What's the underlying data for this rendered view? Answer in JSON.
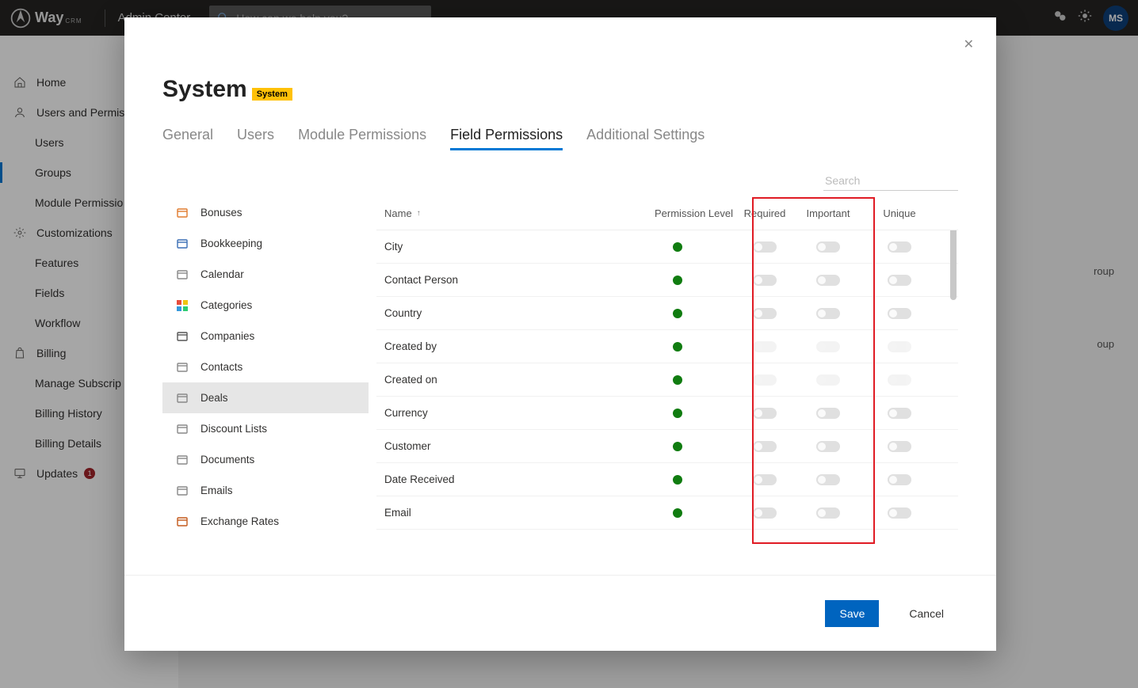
{
  "header": {
    "brand": "Way",
    "brand_sub": "CRM",
    "app_title": "Admin Center",
    "search_placeholder": "How can we help you?",
    "avatar_initials": "MS"
  },
  "sidebar": {
    "items": [
      {
        "label": "Home",
        "icon": "home",
        "sub": false
      },
      {
        "label": "Users and Permissions",
        "icon": "user",
        "sub": false,
        "truncate": true
      },
      {
        "label": "Users",
        "sub": true
      },
      {
        "label": "Groups",
        "sub": true,
        "active": true
      },
      {
        "label": "Module Permissions",
        "sub": true,
        "truncate": true
      },
      {
        "label": "Customizations",
        "icon": "gear",
        "sub": false
      },
      {
        "label": "Features",
        "sub": true
      },
      {
        "label": "Fields",
        "sub": true
      },
      {
        "label": "Workflow",
        "sub": true
      },
      {
        "label": "Billing",
        "icon": "bag",
        "sub": false
      },
      {
        "label": "Manage Subscription",
        "sub": true,
        "truncate": true
      },
      {
        "label": "Billing History",
        "sub": true
      },
      {
        "label": "Billing Details",
        "sub": true
      },
      {
        "label": "Updates",
        "icon": "monitor",
        "sub": false,
        "badge": "1"
      }
    ]
  },
  "modal": {
    "title": "System",
    "tag": "System",
    "tabs": [
      {
        "label": "General"
      },
      {
        "label": "Users"
      },
      {
        "label": "Module Permissions"
      },
      {
        "label": "Field Permissions",
        "active": true
      },
      {
        "label": "Additional Settings"
      }
    ],
    "search_placeholder": "Search",
    "modules": [
      {
        "label": "Bonuses",
        "icon": "#e07b2e"
      },
      {
        "label": "Bookkeeping",
        "icon": "#3b6fb5"
      },
      {
        "label": "Calendar",
        "icon": "#888"
      },
      {
        "label": "Categories",
        "icon": "multi"
      },
      {
        "label": "Companies",
        "icon": "#555"
      },
      {
        "label": "Contacts",
        "icon": "#888"
      },
      {
        "label": "Deals",
        "icon": "#888",
        "selected": true
      },
      {
        "label": "Discount Lists",
        "icon": "#888"
      },
      {
        "label": "Documents",
        "icon": "#888"
      },
      {
        "label": "Emails",
        "icon": "#888"
      },
      {
        "label": "Exchange Rates",
        "icon": "#c45a1d"
      }
    ],
    "columns": {
      "name": "Name",
      "perm": "Permission Level",
      "req": "Required",
      "imp": "Important",
      "unq": "Unique"
    },
    "fields": [
      {
        "name": "City",
        "perm": "green",
        "req": true,
        "imp": true,
        "unq": true
      },
      {
        "name": "Contact Person",
        "perm": "green",
        "req": true,
        "imp": true,
        "unq": true
      },
      {
        "name": "Country",
        "perm": "green",
        "req": true,
        "imp": true,
        "unq": true
      },
      {
        "name": "Created by",
        "perm": "green",
        "req": false,
        "imp": false,
        "unq": false
      },
      {
        "name": "Created on",
        "perm": "green",
        "req": false,
        "imp": false,
        "unq": false
      },
      {
        "name": "Currency",
        "perm": "green",
        "req": true,
        "imp": true,
        "unq": true
      },
      {
        "name": "Customer",
        "perm": "green",
        "req": true,
        "imp": true,
        "unq": true
      },
      {
        "name": "Date Received",
        "perm": "green",
        "req": true,
        "imp": true,
        "unq": true
      },
      {
        "name": "Email",
        "perm": "green",
        "req": true,
        "imp": true,
        "unq": true
      }
    ],
    "footer": {
      "save": "Save",
      "cancel": "Cancel"
    }
  },
  "background_hints": {
    "group_label": "roup",
    "group_label2": "oup"
  }
}
